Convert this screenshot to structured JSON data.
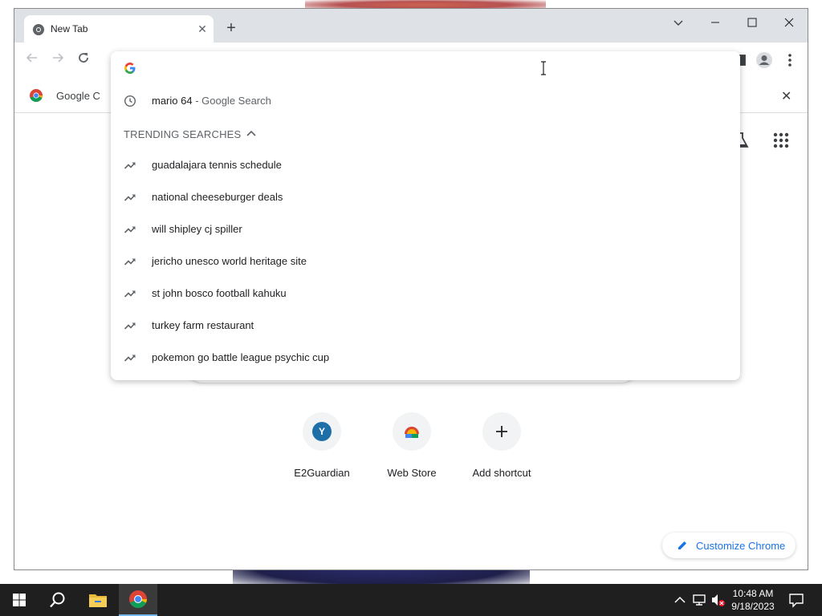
{
  "tab": {
    "title": "New Tab"
  },
  "bookmarks": {
    "item_label": "Google C"
  },
  "omnibox": {
    "value": "",
    "history": {
      "query": "mario 64",
      "suffix": " - Google Search"
    },
    "trending_header": "TRENDING SEARCHES",
    "trending": [
      "guadalajara tennis schedule",
      "national cheeseburger deals",
      "will shipley cj spiller",
      "jericho unesco world heritage site",
      "st john bosco football kahuku",
      "turkey farm restaurant",
      "pokemon go battle league psychic cup"
    ]
  },
  "ntp": {
    "shortcuts": [
      {
        "label": "E2Guardian",
        "initial": "Y"
      },
      {
        "label": "Web Store"
      },
      {
        "label": "Add shortcut"
      }
    ],
    "customize_label": "Customize Chrome"
  },
  "taskbar": {
    "time": "10:48 AM",
    "date": "9/18/2023"
  },
  "colors": {
    "accent": "#1a73e8",
    "taskbar": "#1f1f1f",
    "tabstrip": "#dee1e6"
  }
}
